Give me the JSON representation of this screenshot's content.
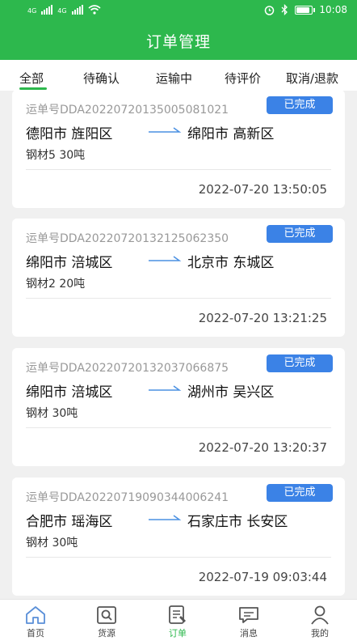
{
  "status_bar": {
    "network_left": "4G",
    "network_right": "4G",
    "time": "10:08",
    "battery_level": 0.9
  },
  "header": {
    "title": "订单管理"
  },
  "tabs": [
    {
      "label": "全部",
      "active": true
    },
    {
      "label": "待确认",
      "active": false
    },
    {
      "label": "运输中",
      "active": false
    },
    {
      "label": "待评价",
      "active": false
    },
    {
      "label": "取消/退款",
      "active": false
    }
  ],
  "orders": [
    {
      "waybill": "运单号DDA20220720135005081021",
      "status": "已完成",
      "from": "德阳市 旌阳区",
      "to": "绵阳市 高新区",
      "cargo": "钢材5 30吨",
      "time": "2022-07-20 13:50:05"
    },
    {
      "waybill": "运单号DDA20220720132125062350",
      "status": "已完成",
      "from": "绵阳市 涪城区",
      "to": "北京市 东城区",
      "cargo": "钢材2 20吨",
      "time": "2022-07-20 13:21:25"
    },
    {
      "waybill": "运单号DDA20220720132037066875",
      "status": "已完成",
      "from": "绵阳市 涪城区",
      "to": "湖州市 吴兴区",
      "cargo": "钢材 30吨",
      "time": "2022-07-20 13:20:37"
    },
    {
      "waybill": "运单号DDA20220719090344006241",
      "status": "已完成",
      "from": "合肥市 瑶海区",
      "to": "石家庄市 长安区",
      "cargo": "钢材 30吨",
      "time": "2022-07-19 09:03:44"
    }
  ],
  "bottom_nav": [
    {
      "label": "首页",
      "icon": "home-icon",
      "active": false
    },
    {
      "label": "货源",
      "icon": "cargo-search-icon",
      "active": false
    },
    {
      "label": "订单",
      "icon": "order-list-icon",
      "active": true
    },
    {
      "label": "消息",
      "icon": "message-icon",
      "active": false
    },
    {
      "label": "我的",
      "icon": "profile-icon",
      "active": false
    }
  ],
  "colors": {
    "brand_green": "#2db84d",
    "badge_blue": "#3b82e6",
    "arrow_blue": "#4a90e2"
  }
}
